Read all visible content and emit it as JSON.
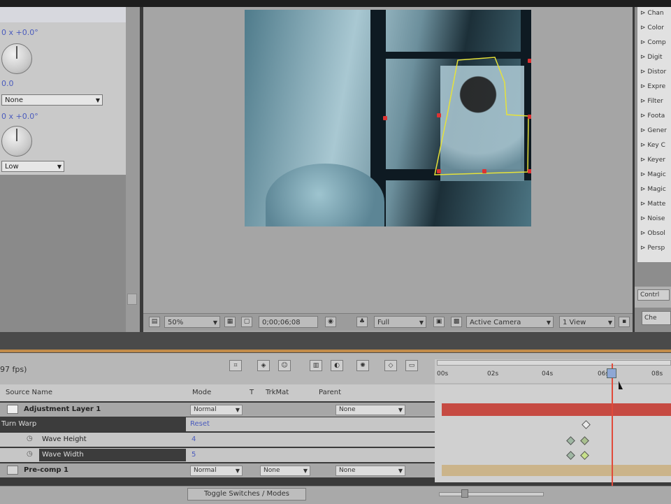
{
  "effect_controls": {
    "property1_value": "0 x +0.0°",
    "property2_value": "0.0",
    "property2_select": "None",
    "property3_value": "0 x +0.0°",
    "property3_select": "Low"
  },
  "viewer": {
    "zoom": "50%",
    "timecode": "0;00;06;08",
    "resolution": "Full",
    "camera": "Active Camera",
    "view": "1 View"
  },
  "presets": {
    "items": [
      "Chan",
      "Color",
      "Comp",
      "Digit",
      "Distor",
      "Expre",
      "Filter",
      "Foota",
      "Gener",
      "Key C",
      "Keyer",
      "Magic",
      "Magic",
      "Matte",
      "Noise",
      "Obsol",
      "Persp"
    ],
    "button1": "Contrl",
    "button2": "Che"
  },
  "timeline": {
    "comp_name": "97 fps)",
    "columns": {
      "source_name": "Source Name",
      "mode": "Mode",
      "t": "T",
      "trkmat": "TrkMat",
      "parent": "Parent"
    },
    "ticks": [
      "00s",
      "02s",
      "04s",
      "06s",
      "08s"
    ],
    "layers": [
      {
        "name": "Adjustment Layer 1",
        "mode": "Normal",
        "parent": "None"
      },
      {
        "name": "Turn Warp",
        "reset": "Reset"
      },
      {
        "name": "Wave Height",
        "value": "4"
      },
      {
        "name": "Wave Width",
        "value": "5"
      },
      {
        "name": "Pre-comp 1",
        "mode": "Normal",
        "trkmat": "None",
        "parent": "None"
      }
    ],
    "toggle_label": "Toggle Switches / Modes"
  },
  "colors": {
    "layer_bar_red": "#c64a42",
    "layer_bar_tan": "#cbb48a",
    "playhead": "#e14a3a"
  }
}
